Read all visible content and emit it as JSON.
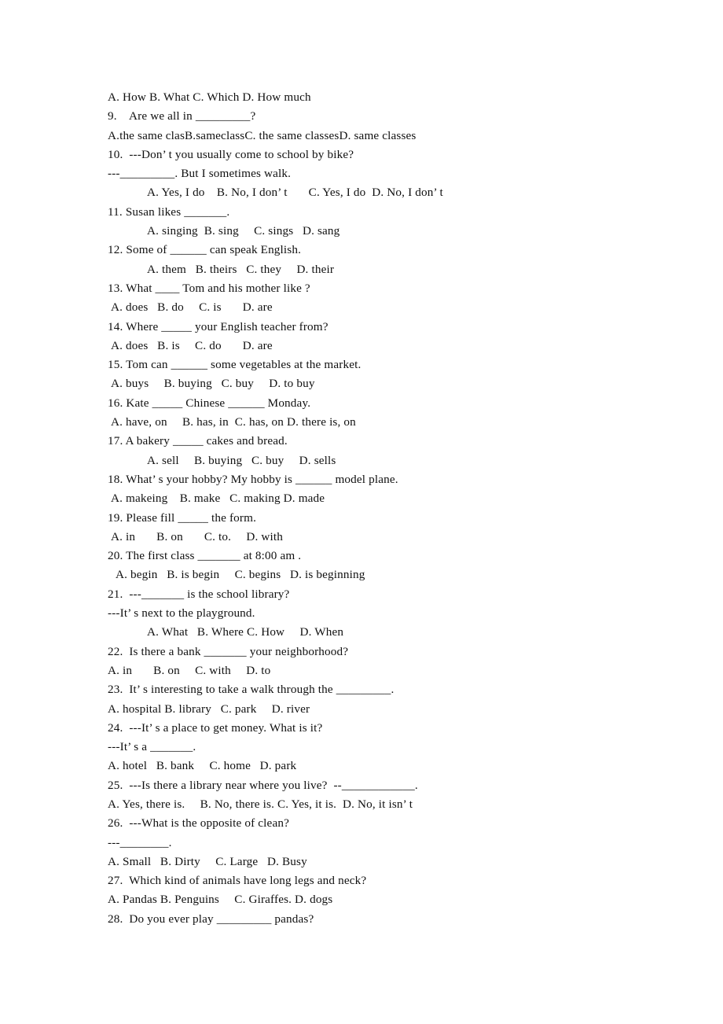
{
  "document": {
    "type": "english-grammar-worksheet",
    "page_background": "#ffffff",
    "text_color": "#101010",
    "lines": [
      {
        "id": "l01",
        "text": "A. How B. What C. Which D. How much",
        "indent": "ind-0"
      },
      {
        "id": "l02",
        "text": "9. Are we all in _________?",
        "indent": "ind-0"
      },
      {
        "id": "l03",
        "text": "A.the same clasB.sameclassC. the same classesD. same classes",
        "indent": "ind-0"
      },
      {
        "id": "l04",
        "text": "10.  ---Don’ t you usually come to school by bike?",
        "indent": "ind-0"
      },
      {
        "id": "l05",
        "text": "---_________. But I sometimes walk.",
        "indent": "ind-0"
      },
      {
        "id": "l06",
        "text": "A. Yes, I do B. No, I don’ t   C. Yes, I do  D. No, I don’ t",
        "indent": "ind-md"
      },
      {
        "id": "l07",
        "text": "11. Susan likes _______.",
        "indent": "ind-0"
      },
      {
        "id": "l08",
        "text": "A. singing  B. sing  C. sings  D. sang",
        "indent": "ind-md"
      },
      {
        "id": "l09",
        "text": "12. Some of ______ can speak English.",
        "indent": "ind-0"
      },
      {
        "id": "l10",
        "text": "A. them  B. theirs  C. they  D. their",
        "indent": "ind-md"
      },
      {
        "id": "l11",
        "text": "13. What ____ Tom and his mother like ?",
        "indent": "ind-0"
      },
      {
        "id": "l12",
        "text": "A. does  B. do  C. is   D. are",
        "indent": "ind-sm"
      },
      {
        "id": "l13",
        "text": "14. Where _____ your English teacher from?",
        "indent": "ind-0"
      },
      {
        "id": "l14",
        "text": "A. does  B. is  C. do   D. are",
        "indent": "ind-sm"
      },
      {
        "id": "l15",
        "text": "15. Tom can ______ some vegetables at the market.",
        "indent": "ind-0"
      },
      {
        "id": "l16",
        "text": "A. buys  B. buying  C. buy  D. to buy",
        "indent": "ind-sm"
      },
      {
        "id": "l17",
        "text": "16. Kate _____ Chinese ______ Monday.",
        "indent": "ind-0"
      },
      {
        "id": "l18",
        "text": "A. have, on  B. has, in  C. has, on D. there is, on",
        "indent": "ind-sm"
      },
      {
        "id": "l19",
        "text": "17. A bakery _____ cakes and bread.",
        "indent": "ind-0"
      },
      {
        "id": "l20",
        "text": "A. sell  B. buying  C. buy  D. sells",
        "indent": "ind-md"
      },
      {
        "id": "l21",
        "text": "18. What’ s your hobby? My hobby is ______ model plane.",
        "indent": "ind-0"
      },
      {
        "id": "l22",
        "text": "A. makeing B. make  C. making D. made",
        "indent": "ind-sm"
      },
      {
        "id": "l23",
        "text": "19. Please fill _____ the form.",
        "indent": "ind-0"
      },
      {
        "id": "l24",
        "text": "A. in   B. on   C. to.  D. with",
        "indent": "ind-sm"
      },
      {
        "id": "l25",
        "text": "20. The first class _______ at 8:00 am .",
        "indent": "ind-0"
      },
      {
        "id": "l26",
        "text": "A. begin  B. is begin  C. begins  D. is beginning",
        "indent": "ind-xs"
      },
      {
        "id": "l27",
        "text": "21.  ---_______ is the school library?",
        "indent": "ind-0"
      },
      {
        "id": "l28",
        "text": "---It’ s next to the playground.",
        "indent": "ind-0"
      },
      {
        "id": "l29",
        "text": "A. What  B. Where C. How  D. When",
        "indent": "ind-md"
      },
      {
        "id": "l30",
        "text": "22.  Is there a bank _______ your neighborhood?",
        "indent": "ind-0"
      },
      {
        "id": "l31",
        "text": "A. in   B. on  C. with  D. to",
        "indent": "ind-0"
      },
      {
        "id": "l32",
        "text": "23.  It’ s interesting to take a walk through the _________.",
        "indent": "ind-0"
      },
      {
        "id": "l33",
        "text": "A. hospital B. library  C. park  D. river",
        "indent": "ind-0"
      },
      {
        "id": "l34",
        "text": "24.  ---It’ s a place to get money. What is it?",
        "indent": "ind-0"
      },
      {
        "id": "l35",
        "text": "---It’ s a _______.",
        "indent": "ind-0"
      },
      {
        "id": "l36",
        "text": "A. hotel  B. bank  C. home  D. park",
        "indent": "ind-0"
      },
      {
        "id": "l37",
        "text": "25.  ---Is there a library near where you live?  --____________.",
        "indent": "ind-0"
      },
      {
        "id": "l38",
        "text": "A. Yes, there is.  B. No, there is. C. Yes, it is.  D. No, it isn’ t",
        "indent": "ind-0"
      },
      {
        "id": "l39",
        "text": "26.  ---What is the opposite of clean?",
        "indent": "ind-0"
      },
      {
        "id": "l40",
        "text": "---________.",
        "indent": "ind-0"
      },
      {
        "id": "l41",
        "text": "A. Small  B. Dirty  C. Large  D. Busy",
        "indent": "ind-0"
      },
      {
        "id": "l42",
        "text": "27.  Which kind of animals have long legs and neck?",
        "indent": "ind-0"
      },
      {
        "id": "l43",
        "text": "A. Pandas B. Penguins  C. Giraffes. D. dogs",
        "indent": "ind-0"
      },
      {
        "id": "l44",
        "text": "28.  Do you ever play _________ pandas?",
        "indent": "ind-0"
      }
    ]
  }
}
